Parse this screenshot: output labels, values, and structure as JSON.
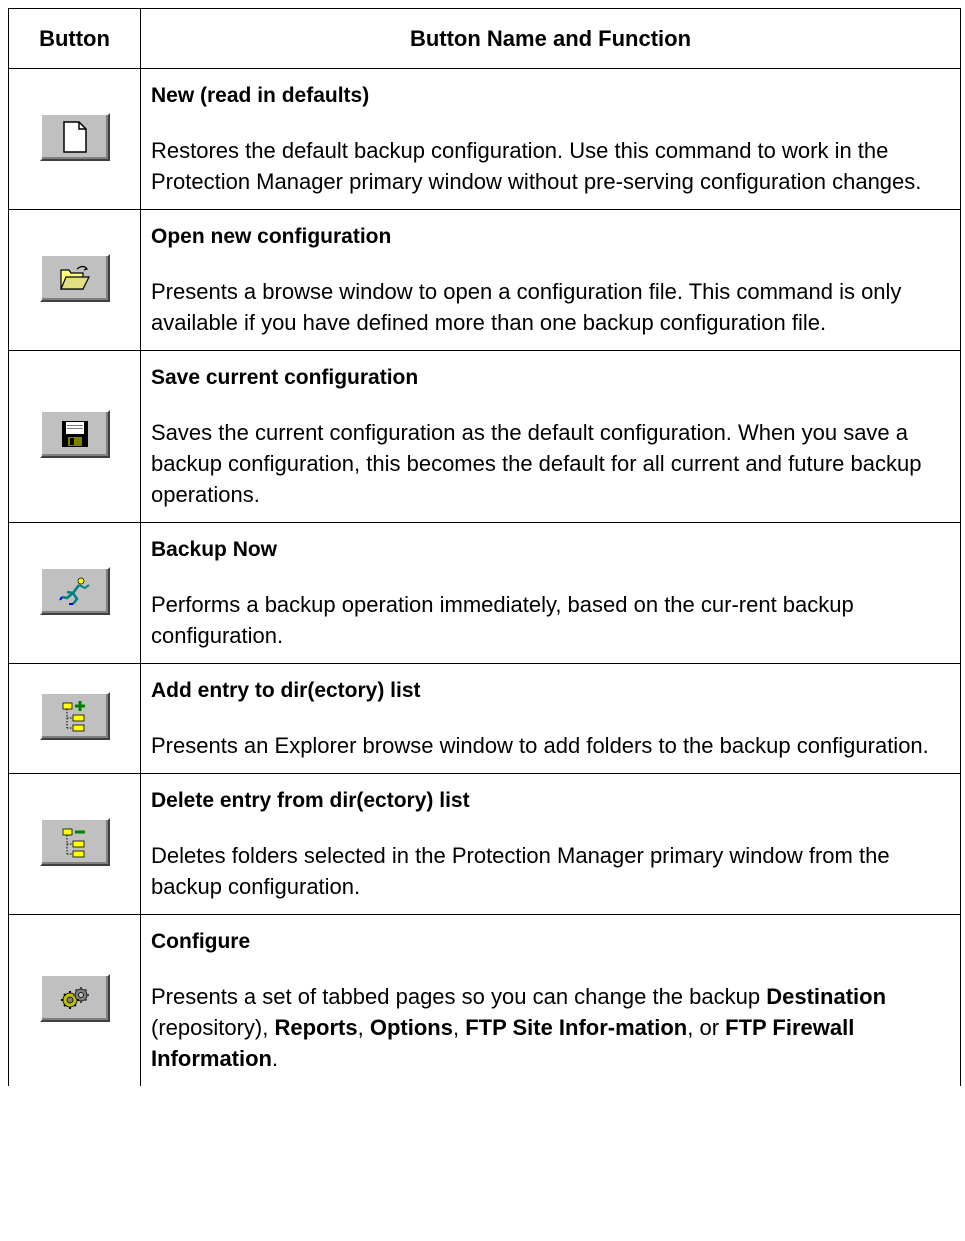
{
  "header": {
    "col_button": "Button",
    "col_function": "Button Name and Function"
  },
  "rows": [
    {
      "icon": "new-document-icon",
      "title": "New (read in defaults)",
      "desc": "Restores the default backup configuration. Use this command to work in the Protection Manager primary window without pre-serving configuration changes."
    },
    {
      "icon": "open-folder-icon",
      "title": "Open new configuration",
      "desc": "Presents a browse window to open a configuration file. This command is only available if you have defined more than one backup configuration file."
    },
    {
      "icon": "floppy-save-icon",
      "title": "Save current configuration",
      "desc": "Saves the current configuration as the default configuration. When you save a backup configuration, this becomes the default for all current and future backup operations."
    },
    {
      "icon": "running-man-icon",
      "title": "Backup Now",
      "desc": "Performs a backup operation immediately, based on the cur-rent backup configuration."
    },
    {
      "icon": "tree-add-icon",
      "title": "Add entry to dir(ectory) list",
      "desc": "Presents an Explorer browse window to add folders to the backup configuration."
    },
    {
      "icon": "tree-delete-icon",
      "title": "Delete entry from dir(ectory) list",
      "desc": "Deletes folders selected in the Protection Manager primary window from the backup configuration."
    },
    {
      "icon": "gear-configure-icon",
      "title": "Configure",
      "desc_parts": {
        "t1": "Presents a set of tabbed pages so you can change the backup ",
        "b1": "Destination",
        "t2": " (repository), ",
        "b2": "Reports",
        "t3": ", ",
        "b3": "Options",
        "t4": ", ",
        "b4": "FTP Site Infor-mation",
        "t5": ", or ",
        "b5": "FTP Firewall Information",
        "t6": "."
      }
    }
  ]
}
